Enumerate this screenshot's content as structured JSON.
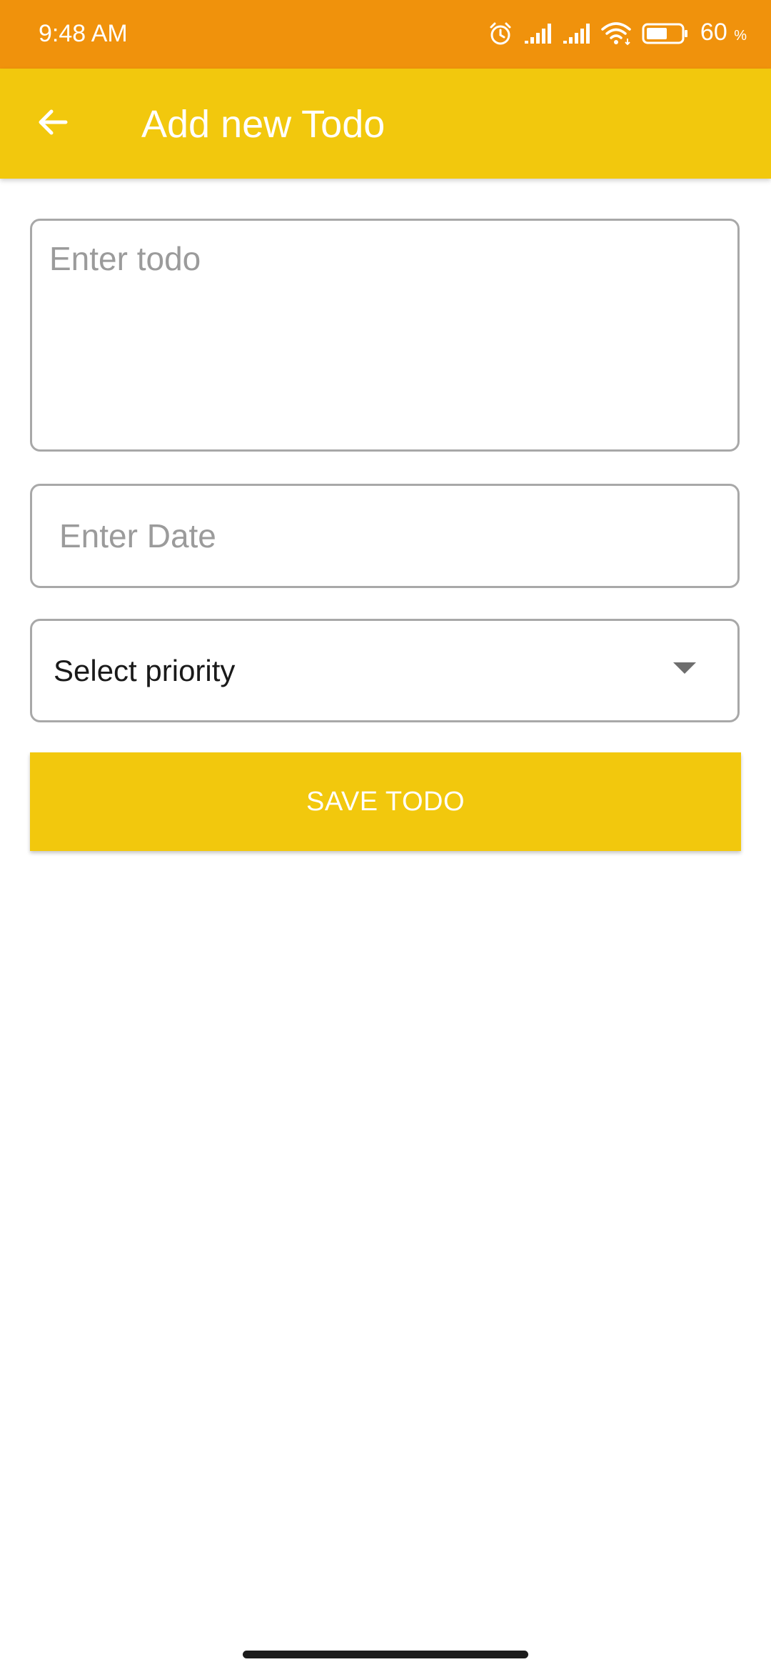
{
  "status_bar": {
    "time": "9:48 AM",
    "battery_percent": "60",
    "battery_unit": "%",
    "battery_level": 0.6,
    "icons": [
      "alarm-icon",
      "signal-icon",
      "signal-icon",
      "wifi-icon",
      "battery-icon"
    ]
  },
  "app_bar": {
    "title": "Add new Todo",
    "back_icon": "arrow-back-icon"
  },
  "form": {
    "todo_placeholder": "Enter todo",
    "todo_value": "",
    "date_placeholder": "Enter Date",
    "date_value": "",
    "priority_label": "Select priority",
    "save_label": "SAVE TODO"
  },
  "colors": {
    "status_bar": "#f0920c",
    "app_bar": "#f2c80d",
    "button": "#f2c80d",
    "border": "#a8a8a8"
  }
}
